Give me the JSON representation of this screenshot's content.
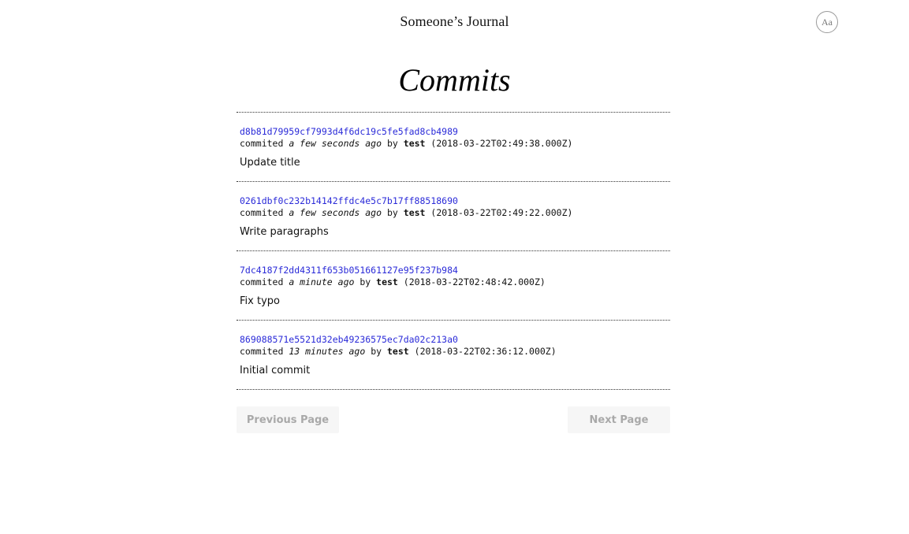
{
  "header": {
    "site_title": "Someone’s Journal",
    "font_toggle_label": "Aa"
  },
  "page": {
    "heading": "Commits"
  },
  "commits": [
    {
      "hash": "d8b81d79959cf7993d4f6dc19c5fe5fad8cb4989",
      "prefix": "commited",
      "relative_time": "a few seconds ago",
      "by": "by",
      "author": "test",
      "timestamp": "(2018-03-22T02:49:38.000Z)",
      "message": "Update title"
    },
    {
      "hash": "0261dbf0c232b14142ffdc4e5c7b17ff88518690",
      "prefix": "commited",
      "relative_time": "a few seconds ago",
      "by": "by",
      "author": "test",
      "timestamp": "(2018-03-22T02:49:22.000Z)",
      "message": "Write paragraphs"
    },
    {
      "hash": "7dc4187f2dd4311f653b051661127e95f237b984",
      "prefix": "commited",
      "relative_time": "a minute ago",
      "by": "by",
      "author": "test",
      "timestamp": "(2018-03-22T02:48:42.000Z)",
      "message": "Fix typo"
    },
    {
      "hash": "869088571e5521d32eb49236575ec7da02c213a0",
      "prefix": "commited",
      "relative_time": "13 minutes ago",
      "by": "by",
      "author": "test",
      "timestamp": "(2018-03-22T02:36:12.000Z)",
      "message": "Initial commit"
    }
  ],
  "pagination": {
    "previous_label": "Previous Page",
    "next_label": "Next Page",
    "disabled_text_color": "#a9a9a9"
  },
  "colors": {
    "link": "#2a2ad8",
    "button_bg": "#f6f6f6"
  }
}
